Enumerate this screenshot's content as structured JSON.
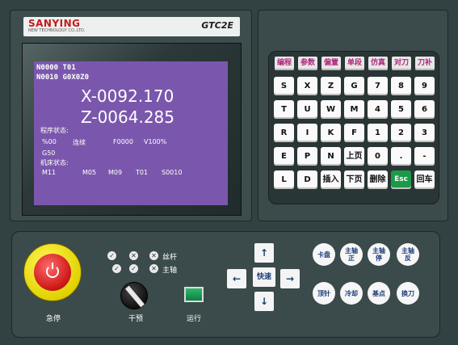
{
  "brand": {
    "name": "SANYING",
    "tagline": "NEW TECHNOLOGY CO.,LTD.",
    "model": "GTC2E"
  },
  "screen": {
    "line1": "N0000 T01",
    "line2": "N0010 G0X0Z0",
    "x": "X-0092.170",
    "z": "Z-0064.285",
    "prog_status_label": "程序状态:",
    "speed": "%00",
    "mode": "连续",
    "feed": "F0000",
    "v": "V100%",
    "g": "G50",
    "machine_status_label": "机床状态:",
    "m1": "M11",
    "m2": "M05",
    "m3": "M09",
    "t": "T01",
    "s": "S0010"
  },
  "func_keys": [
    "编程",
    "参数",
    "偏置",
    "单段",
    "仿真",
    "对刀",
    "刀补"
  ],
  "keys": [
    [
      "S",
      "X",
      "Z",
      "G",
      "7",
      "8",
      "9"
    ],
    [
      "T",
      "U",
      "W",
      "M",
      "4",
      "5",
      "6"
    ],
    [
      "R",
      "I",
      "K",
      "F",
      "1",
      "2",
      "3"
    ],
    [
      "E",
      "P",
      "N",
      "上页",
      "0",
      ".",
      "-"
    ],
    [
      "L",
      "D",
      "插入",
      "下页",
      "删除",
      "Esc",
      "回车"
    ]
  ],
  "estop": {
    "label": "急停"
  },
  "indicators": {
    "screw_label": "丝杆",
    "spindle_label": "主轴"
  },
  "knob": {
    "label": "干预"
  },
  "run": {
    "label": "运行"
  },
  "jog": {
    "up": "↑",
    "down": "↓",
    "left": "←",
    "right": "→",
    "fast": "快速"
  },
  "round_keys": [
    {
      "label": "卡盘"
    },
    {
      "label": "主轴正"
    },
    {
      "label": "主轴停"
    },
    {
      "label": "主轴反"
    },
    {
      "label": "顶针"
    },
    {
      "label": "冷却"
    },
    {
      "label": "基点"
    },
    {
      "label": "换刀"
    }
  ]
}
